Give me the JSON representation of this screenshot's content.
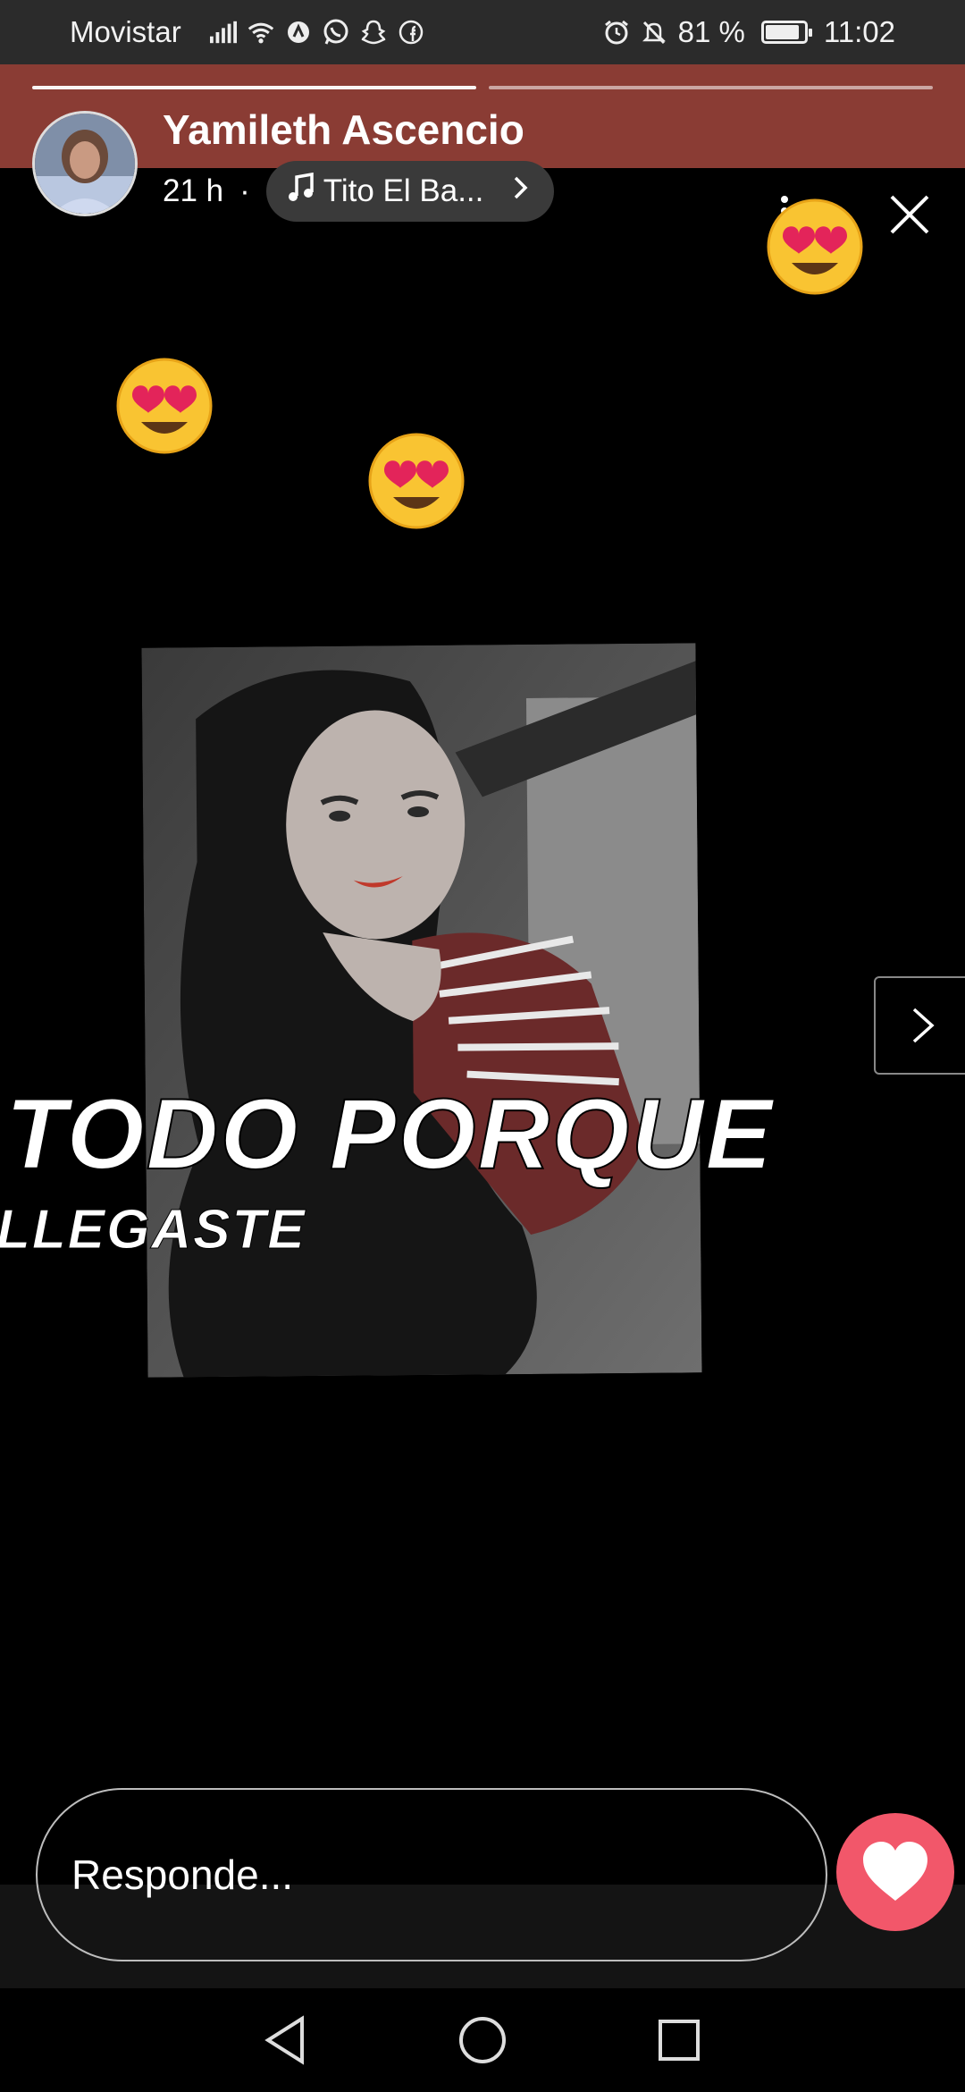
{
  "status_bar": {
    "carrier": "Movistar",
    "battery_text": "81 %",
    "battery_level": 0.81,
    "time": "11:02",
    "icons": [
      "signal-icon",
      "wifi-icon",
      "app-notification-icon",
      "whatsapp-icon",
      "snapchat-icon",
      "facebook-icon",
      "alarm-icon",
      "bell-off-icon",
      "battery-icon"
    ]
  },
  "story": {
    "progress_segments": 2,
    "current_segment": 1,
    "user_name": "Yamileth Ascencio",
    "time_ago": "21 h",
    "separator": "·",
    "music_label": "Tito El Ba...",
    "caption_line_1": "TODO PORQUE",
    "caption_line_2": "LLEGASTE",
    "stickers": [
      "heart-eyes-emoji",
      "heart-eyes-emoji",
      "heart-eyes-emoji"
    ]
  },
  "reply": {
    "placeholder": "Responde..."
  },
  "colors": {
    "header": "#8a3c34",
    "like_button": "#f2576a",
    "background": "#000000"
  }
}
